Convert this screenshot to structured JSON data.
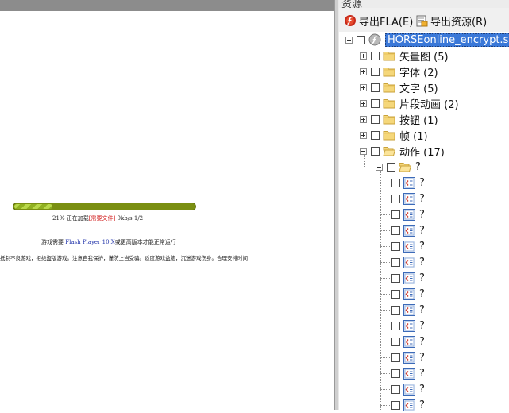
{
  "preview": {
    "loading_progress": 0.21,
    "loading_percent": "21%",
    "loading_text": "正在加载",
    "loading_warning": "[需要文件]",
    "loading_speed": "0kb/s",
    "loading_count": "1/2",
    "player_prefix": "游戏需要",
    "player_version": "Flash Player 10.X",
    "player_suffix": "或更高版本才能正常运行",
    "notice": "抵制不良游戏，拒绝盗版游戏。注意自我保护，谨防上当受骗。适度游戏益脑，沉迷游戏伤身。合理安排时间"
  },
  "panel": {
    "title": "资源",
    "toolbar": {
      "export_fla": "导出FLA(E)",
      "export_resources": "导出资源(R)"
    },
    "tree": {
      "root": "HORSEonline_encrypt.swf",
      "folders": [
        {
          "label": "矢量图 (5)"
        },
        {
          "label": "字体 (2)"
        },
        {
          "label": "文字 (5)"
        },
        {
          "label": "片段动画 (2)"
        },
        {
          "label": "按钮 (1)"
        },
        {
          "label": "帧 (1)"
        },
        {
          "label": "动作 (17)"
        }
      ],
      "action_subfolder": "?",
      "action_items": [
        "?",
        "?",
        "?",
        "?",
        "?",
        "?",
        "?",
        "?",
        "?",
        "?",
        "?",
        "?",
        "?",
        "?",
        "?"
      ]
    }
  },
  "colors": {
    "selection": "#3a78d8",
    "progress": "#7a8f12",
    "warning": "#d22020",
    "link": "#1b2ea8"
  },
  "icons": [
    "export-fla-icon",
    "export-resources-icon",
    "swf-file-icon",
    "folder-icon",
    "folder-open-icon",
    "action-script-icon"
  ]
}
